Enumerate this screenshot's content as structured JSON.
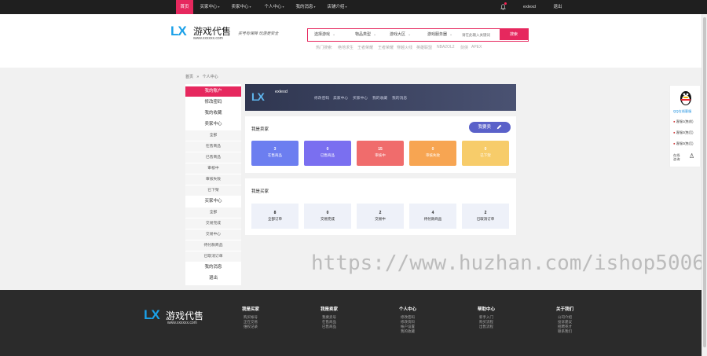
{
  "topnav": {
    "items": [
      {
        "label": "首页",
        "dropdown": false
      },
      {
        "label": "买家中心",
        "dropdown": true
      },
      {
        "label": "卖家中心",
        "dropdown": true
      },
      {
        "label": "个人中心",
        "dropdown": true
      },
      {
        "label": "我的消息",
        "dropdown": true
      },
      {
        "label": "店铺介绍",
        "dropdown": true
      }
    ],
    "username": "exlexd",
    "logout": "退出"
  },
  "header": {
    "logo_mark": "LX",
    "logo_name": "游戏代售",
    "logo_url": "www.xxxxxx.com",
    "slogan": "买号有保障  玩游更安全",
    "search": {
      "selects": [
        "选择游戏",
        "物品类型",
        "游戏大区",
        "游戏服务器"
      ],
      "placeholder": "请在此输入关键词",
      "button": "搜索"
    },
    "hot_label": "热门搜索:",
    "hot_items": [
      "绝地求生",
      "王者荣耀",
      "王者荣耀",
      "穿越火线",
      "英雄联盟",
      "NBA2OL2",
      "剑侠",
      "APEX"
    ]
  },
  "breadcrumb": {
    "home": "首页",
    "sep": "»",
    "current": "个人中心"
  },
  "sidebar": [
    {
      "label": "我的账户",
      "kind": "active"
    },
    {
      "label": "修改密码",
      "kind": "item"
    },
    {
      "label": "我的收藏",
      "kind": "item"
    },
    {
      "label": "卖家中心",
      "kind": "head"
    },
    {
      "label": "全部",
      "kind": "sub"
    },
    {
      "label": "在售商品",
      "kind": "sub"
    },
    {
      "label": "已售商品",
      "kind": "sub"
    },
    {
      "label": "审核中",
      "kind": "sub"
    },
    {
      "label": "审核失败",
      "kind": "sub"
    },
    {
      "label": "已下架",
      "kind": "sub"
    },
    {
      "label": "买家中心",
      "kind": "head"
    },
    {
      "label": "全部",
      "kind": "sub"
    },
    {
      "label": "交易完成",
      "kind": "sub"
    },
    {
      "label": "交易中心",
      "kind": "sub"
    },
    {
      "label": "待付款商品",
      "kind": "sub"
    },
    {
      "label": "已取消订单",
      "kind": "sub"
    },
    {
      "label": "我的消息",
      "kind": "item"
    },
    {
      "label": "退出",
      "kind": "item"
    }
  ],
  "profile": {
    "username": "exlexd",
    "links": [
      "修改密码",
      "卖家中心",
      "买家中心",
      "我的收藏",
      "我的消息"
    ]
  },
  "seller": {
    "title": "我是卖家",
    "sell_button": "我要卖",
    "stats": [
      {
        "value": "3",
        "label": "在售商品",
        "color": "#6c7ef0"
      },
      {
        "value": "0",
        "label": "已售商品",
        "color": "#7a6ff0"
      },
      {
        "value": "15",
        "label": "审核中",
        "color": "#f06c6c"
      },
      {
        "value": "0",
        "label": "审核失败",
        "color": "#f7a552"
      },
      {
        "value": "0",
        "label": "已下架",
        "color": "#f7cc6a"
      }
    ]
  },
  "buyer": {
    "title": "我是买家",
    "stats": [
      {
        "value": "8",
        "label": "全部订单"
      },
      {
        "value": "0",
        "label": "交易完成"
      },
      {
        "value": "2",
        "label": "交易中"
      },
      {
        "value": "4",
        "label": "待付款商品"
      },
      {
        "value": "2",
        "label": "已取消订单"
      }
    ]
  },
  "float_panel": {
    "title": "QQ在线客服",
    "items": [
      "客服1(售前)",
      "客服2(售后)",
      "客服3(售后)"
    ],
    "bottom": [
      "在线\n咨询",
      "提醒"
    ]
  },
  "footer": {
    "logo_mark": "LX",
    "logo_name": "游戏代售",
    "logo_url": "www.xxxxxx.com",
    "columns": [
      {
        "title": "我是买家",
        "items": [
          "购买帐号",
          "正在交易",
          "维权记录"
        ]
      },
      {
        "title": "我是卖家",
        "items": [
          "我要卖号",
          "在售商品",
          "已售商品"
        ]
      },
      {
        "title": "个人中心",
        "items": [
          "修改密码",
          "修改资料",
          "帐户设置",
          "我的收藏"
        ]
      },
      {
        "title": "帮助中心",
        "items": [
          "新手入门",
          "购买流程",
          "出售流程"
        ]
      },
      {
        "title": "关于我们",
        "items": [
          "公司介绍",
          "投诉建议",
          "招聘英才",
          "联系我们"
        ]
      }
    ]
  },
  "watermark": "https://www.huzhan.com/ishop50065"
}
